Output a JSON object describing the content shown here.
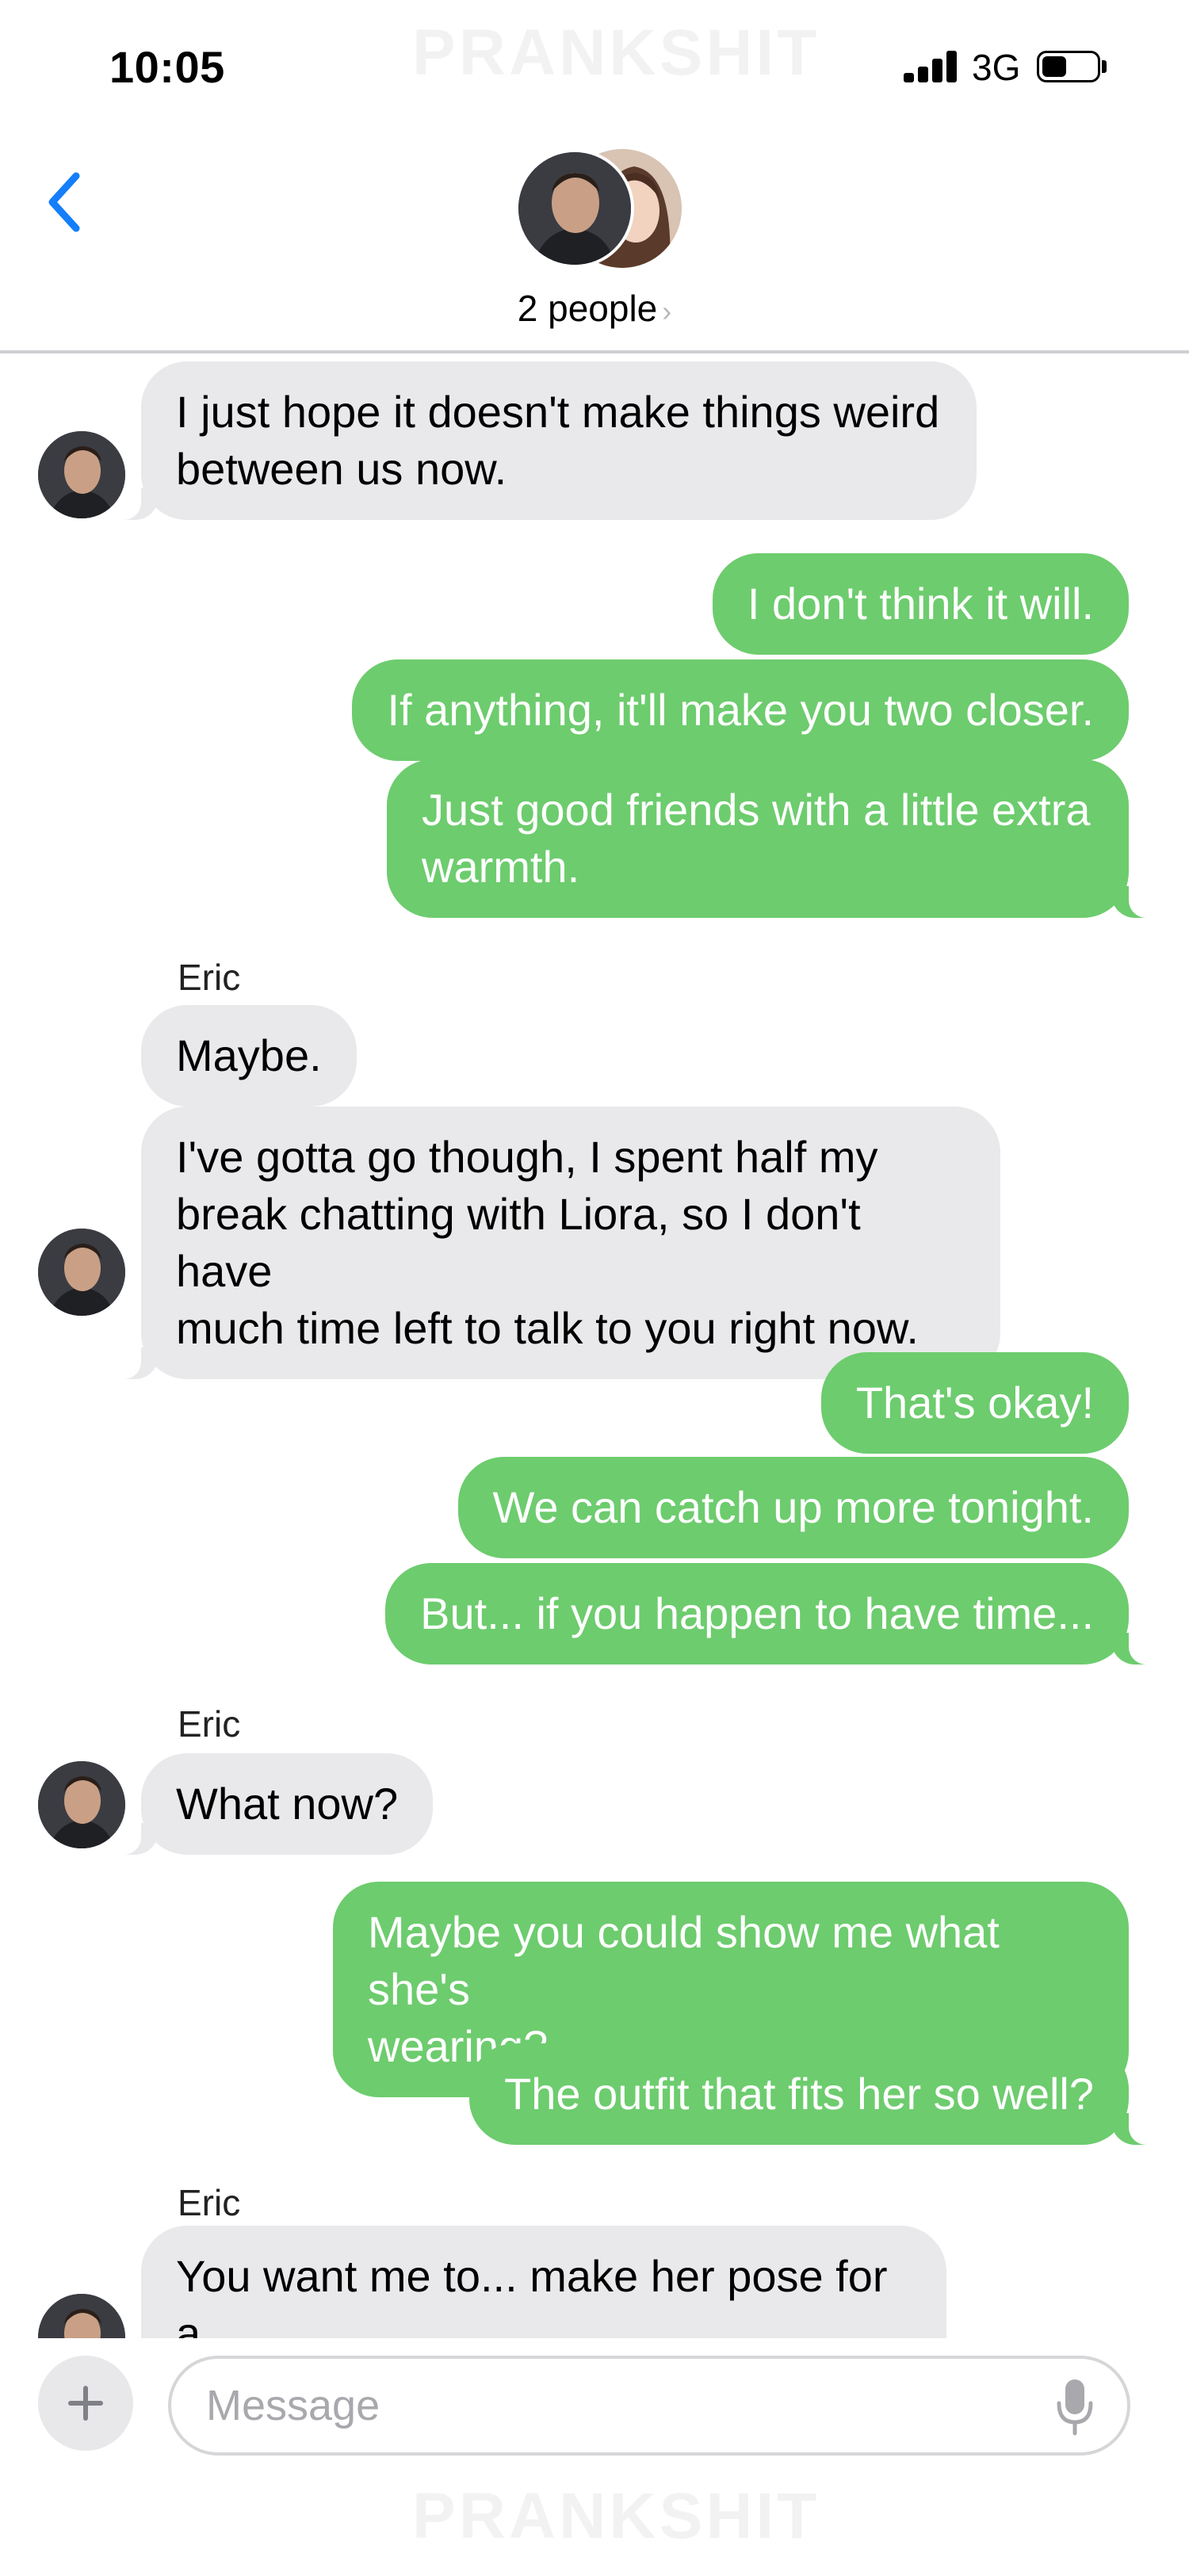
{
  "status_bar": {
    "time": "10:05",
    "network": "3G",
    "signal_bars": 4,
    "battery_level": 0.45
  },
  "watermark": "PRANKSHIT",
  "header": {
    "back_icon": "chevron-left-icon",
    "participants_label": "2 people",
    "chevron": "›",
    "accent_color": "#147efb"
  },
  "colors": {
    "sent_bubble": "#6dcc6e",
    "received_bubble": "#e9e9eb"
  },
  "messages": [
    {
      "id": "m1",
      "dir": "recv",
      "text": "I just hope it doesn't make things weird\nbetween us now."
    },
    {
      "id": "m2",
      "dir": "sent",
      "text": "I don't think it will."
    },
    {
      "id": "m3",
      "dir": "sent",
      "text": "If anything, it'll make you two closer."
    },
    {
      "id": "m4",
      "dir": "sent",
      "text": "Just good friends with a little extra\nwarmth."
    },
    {
      "id": "m5",
      "dir": "recv",
      "sender": "Eric",
      "text": "Maybe."
    },
    {
      "id": "m6",
      "dir": "recv",
      "text": "I've gotta go though, I spent half my\nbreak chatting with Liora, so I don't have\nmuch time left to talk to you right now."
    },
    {
      "id": "m7",
      "dir": "sent",
      "text": "That's okay!"
    },
    {
      "id": "m8",
      "dir": "sent",
      "text": "We can catch up more tonight."
    },
    {
      "id": "m9",
      "dir": "sent",
      "text": "But... if you happen to have time..."
    },
    {
      "id": "m10",
      "dir": "recv",
      "sender": "Eric",
      "text": "What now?"
    },
    {
      "id": "m11",
      "dir": "sent",
      "text": "Maybe you could show me what she's\nwearing?"
    },
    {
      "id": "m12",
      "dir": "sent",
      "text": "The outfit that fits her so well?"
    },
    {
      "id": "m13",
      "dir": "recv",
      "sender": "Eric",
      "text": "You want me to... make her pose for a\npicture or something?!"
    }
  ],
  "input_bar": {
    "placeholder": "Message",
    "value": "",
    "plus_icon": "plus-icon",
    "mic_icon": "microphone-icon"
  }
}
